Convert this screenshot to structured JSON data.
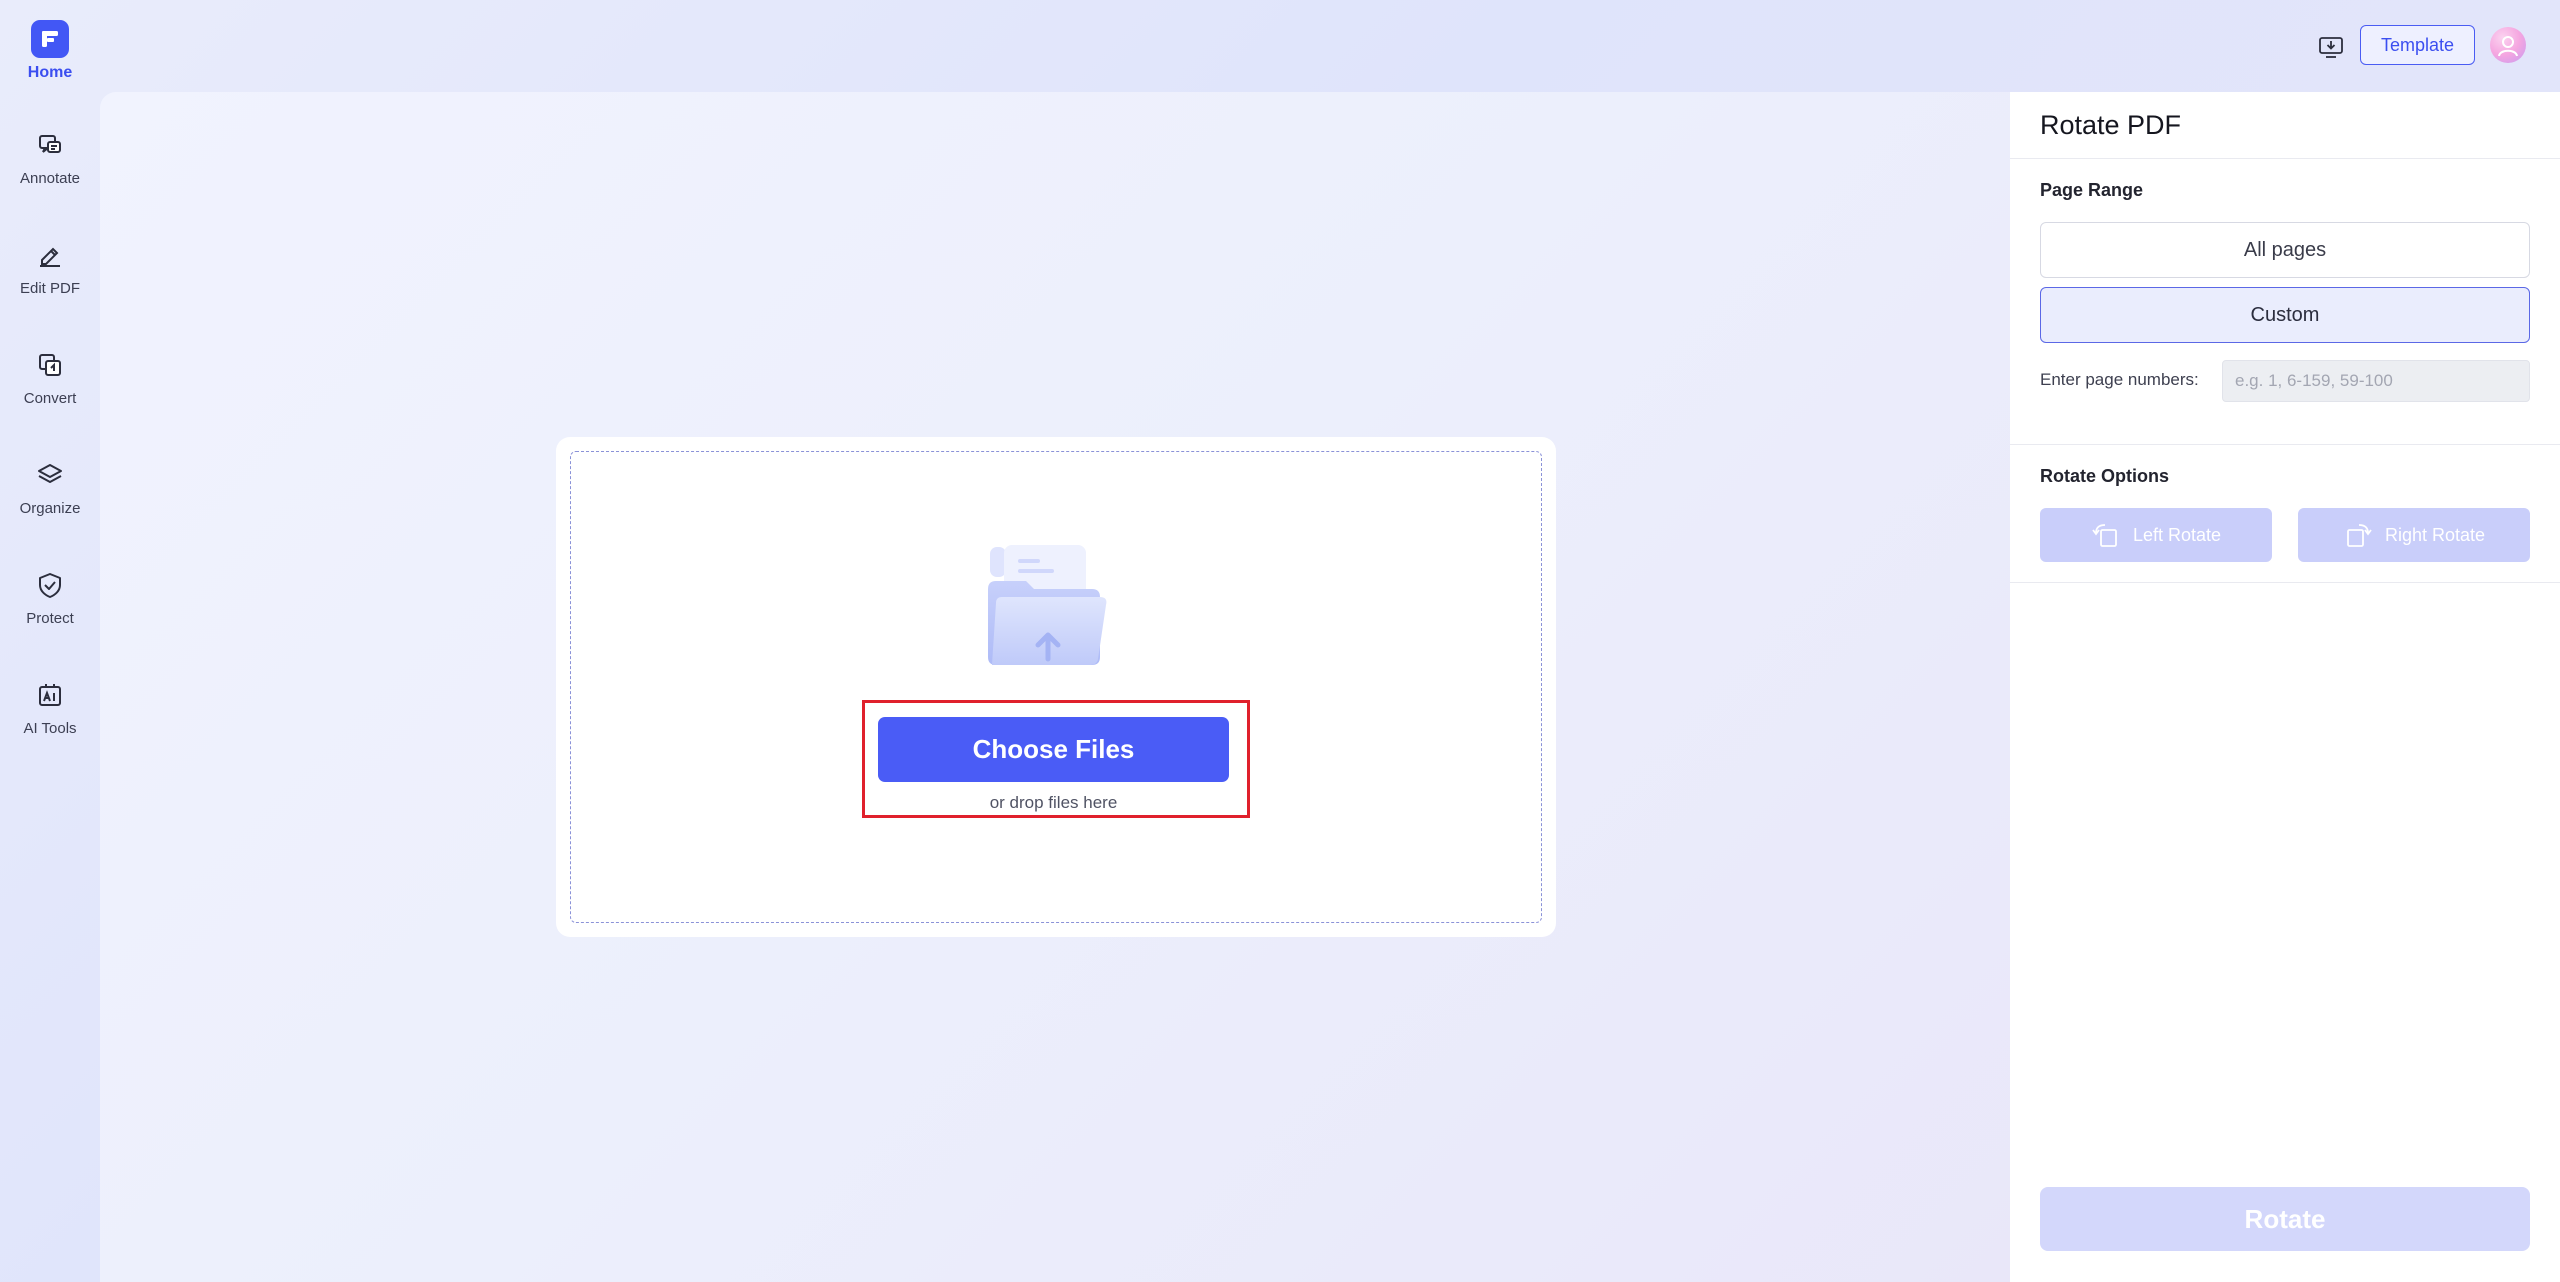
{
  "sidebar": {
    "home_label": "Home",
    "items": [
      {
        "label": "Annotate",
        "icon": "annotate-icon"
      },
      {
        "label": "Edit PDF",
        "icon": "edit-pdf-icon"
      },
      {
        "label": "Convert",
        "icon": "convert-icon"
      },
      {
        "label": "Organize",
        "icon": "organize-icon"
      },
      {
        "label": "Protect",
        "icon": "protect-icon"
      },
      {
        "label": "AI Tools",
        "icon": "ai-tools-icon"
      }
    ]
  },
  "header": {
    "template_label": "Template"
  },
  "upload": {
    "choose_label": "Choose Files",
    "drop_hint": "or drop files here"
  },
  "panel": {
    "title": "Rotate PDF",
    "page_range_label": "Page Range",
    "all_pages_label": "All pages",
    "custom_label": "Custom",
    "page_numbers_label": "Enter page numbers:",
    "page_numbers_placeholder": "e.g. 1, 6-159, 59-100",
    "rotate_options_label": "Rotate Options",
    "left_rotate_label": "Left Rotate",
    "right_rotate_label": "Right Rotate",
    "rotate_label": "Rotate"
  },
  "colors": {
    "accent": "#4a5cf6",
    "highlight": "#e0202c",
    "disabled_button": "#c9cefa"
  }
}
